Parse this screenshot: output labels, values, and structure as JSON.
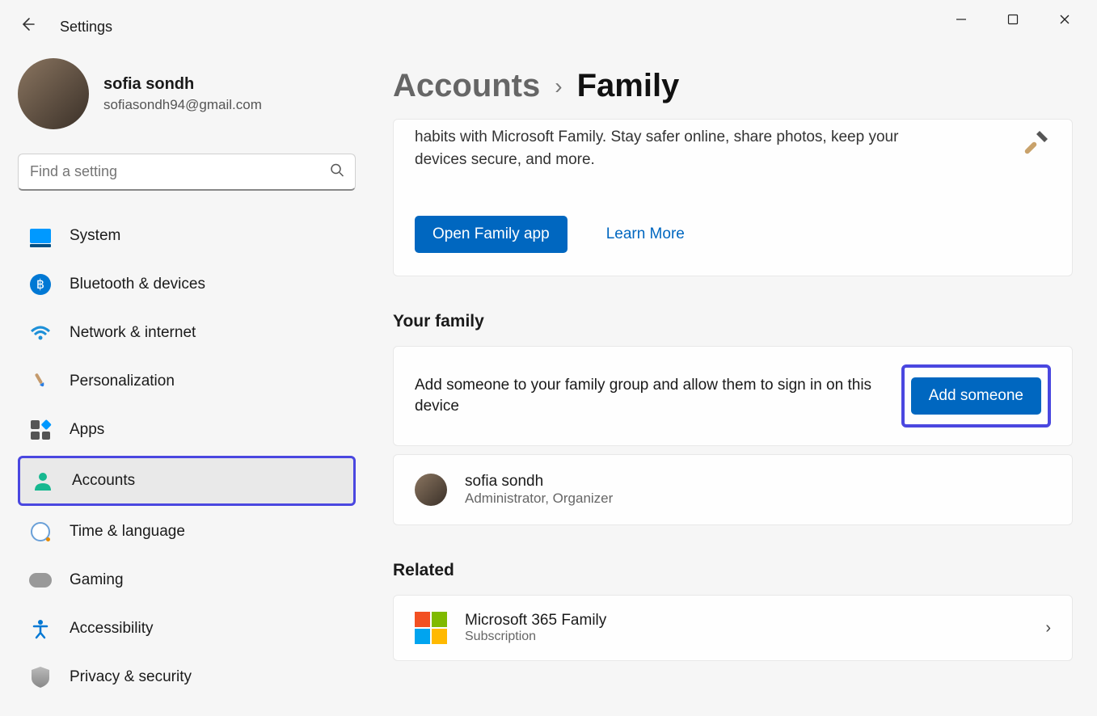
{
  "app": {
    "title": "Settings"
  },
  "user": {
    "name": "sofia sondh",
    "email": "sofiasondh94@gmail.com"
  },
  "search": {
    "placeholder": "Find a setting"
  },
  "sidebar": {
    "items": [
      {
        "label": "System"
      },
      {
        "label": "Bluetooth & devices"
      },
      {
        "label": "Network & internet"
      },
      {
        "label": "Personalization"
      },
      {
        "label": "Apps"
      },
      {
        "label": "Accounts"
      },
      {
        "label": "Time & language"
      },
      {
        "label": "Gaming"
      },
      {
        "label": "Accessibility"
      },
      {
        "label": "Privacy & security"
      }
    ]
  },
  "breadcrumb": {
    "parent": "Accounts",
    "current": "Family"
  },
  "family_card": {
    "description": "habits with Microsoft Family. Stay safer online, share photos, keep your devices secure, and more.",
    "open_button": "Open Family app",
    "learn_more": "Learn More"
  },
  "your_family": {
    "title": "Your family",
    "add_text": "Add someone to your family group and allow them to sign in on this device",
    "add_button": "Add someone",
    "member": {
      "name": "sofia sondh",
      "role": "Administrator, Organizer"
    }
  },
  "related": {
    "title": "Related",
    "item": {
      "title": "Microsoft 365 Family",
      "subtitle": "Subscription"
    }
  }
}
